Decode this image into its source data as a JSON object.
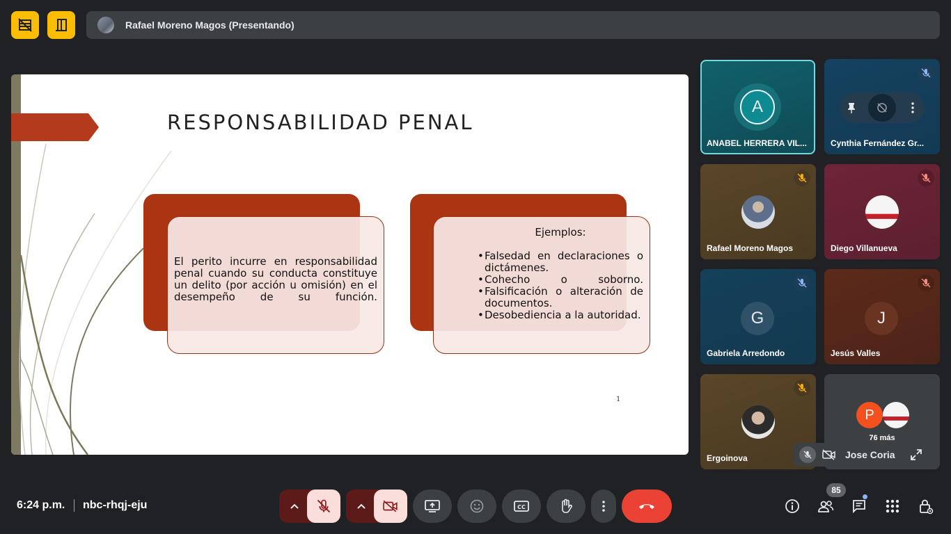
{
  "presenter_bar": {
    "name": "Rafael Moreno Magos (Presentando)"
  },
  "slide": {
    "title": "RESPONSABILIDAD PENAL",
    "box1_text": "El perito incurre en responsabilidad penal cuando su conducta constituye un delito (por acción u omisión) en el desempeño de su función.",
    "box2_heading": "Ejemplos:",
    "box2_items": [
      "Falsedad en declaraciones o dictámenes.",
      "Cohecho o soborno.",
      "Falsificación o alteración de documentos.",
      "Desobediencia a la autoridad."
    ],
    "page_number": "1"
  },
  "participants": [
    {
      "name": "ANABEL HERRERA VIL...",
      "initial": "A"
    },
    {
      "name": "Cynthia Fernández Gr..."
    },
    {
      "name": "Rafael Moreno Magos"
    },
    {
      "name": "Diego Villanueva"
    },
    {
      "name": "Gabriela Arredondo",
      "initial": "G"
    },
    {
      "name": "Jesús Valles",
      "initial": "J"
    },
    {
      "name": "Ergoinova"
    }
  ],
  "more_tile": {
    "initial": "P",
    "label": "76 más"
  },
  "self_view": {
    "name": "Jose Coria"
  },
  "footer": {
    "time": "6:24 p.m.",
    "meeting_code": "nbc-rhqj-eju"
  },
  "people_count": "85",
  "icons": [
    "lines-off-icon",
    "exit-door-icon",
    "pin-icon",
    "mic-off-icon",
    "camera-off-icon",
    "present-screen-icon",
    "emoji-icon",
    "captions-icon",
    "raise-hand-icon",
    "more-vert-icon",
    "end-call-icon",
    "info-icon",
    "people-icon",
    "chat-icon",
    "apps-icon",
    "host-controls-icon",
    "expand-icon"
  ],
  "colors": {
    "accent_yellow": "#fbbc04",
    "end_call_red": "#ea4335",
    "muted_bg": "#f9dedc",
    "slide_red": "#ab3413",
    "active_speaker": "#76d6e0"
  }
}
